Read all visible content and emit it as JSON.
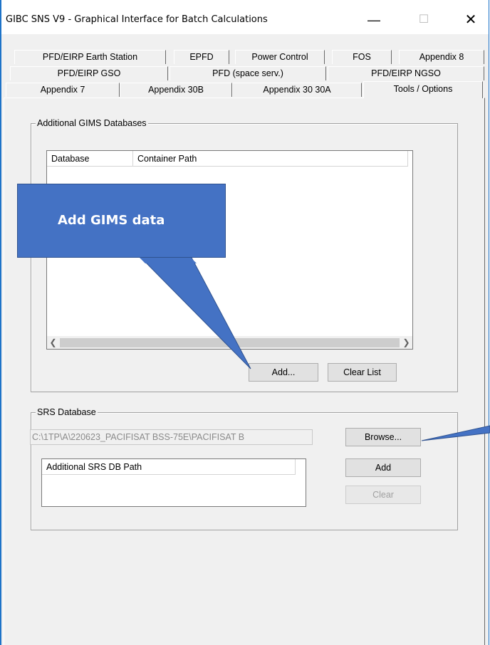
{
  "window": {
    "title": "GIBC SNS V9 - Graphical Interface for Batch Calculations",
    "minimize_glyph": "—",
    "maximize_glyph": "☐",
    "close_glyph": "✕"
  },
  "tabs": {
    "row1": [
      "PFD/EIRP Earth Station",
      "EPFD",
      "Power Control",
      "FOS",
      "Appendix 8"
    ],
    "row2": [
      "PFD/EIRP GSO",
      "PFD (space serv.)",
      "PFD/EIRP NGSO"
    ],
    "row3": [
      "Appendix 7",
      "Appendix 30B",
      "Appendix 30 30A",
      "Tools / Options"
    ],
    "active": "Tools / Options"
  },
  "gims_group": {
    "label": "Additional GIMS Databases",
    "columns": [
      "Database",
      "Container Path"
    ],
    "rows": [],
    "add_button": "Add...",
    "clear_button": "Clear List"
  },
  "srs_group": {
    "label": "SRS Database",
    "path_value": "C:\\1TP\\A\\220623_PACIFISAT BSS-75E\\PACIFISAT B",
    "browse_button": "Browse...",
    "additional_column": "Additional SRS DB Path",
    "add_button": "Add",
    "clear_button": "Clear"
  },
  "callout": {
    "text": "Add GIMS data",
    "fill_color": "#4472c4"
  },
  "scroll_icons": [
    "chevron-left-icon",
    "chevron-right-icon"
  ]
}
